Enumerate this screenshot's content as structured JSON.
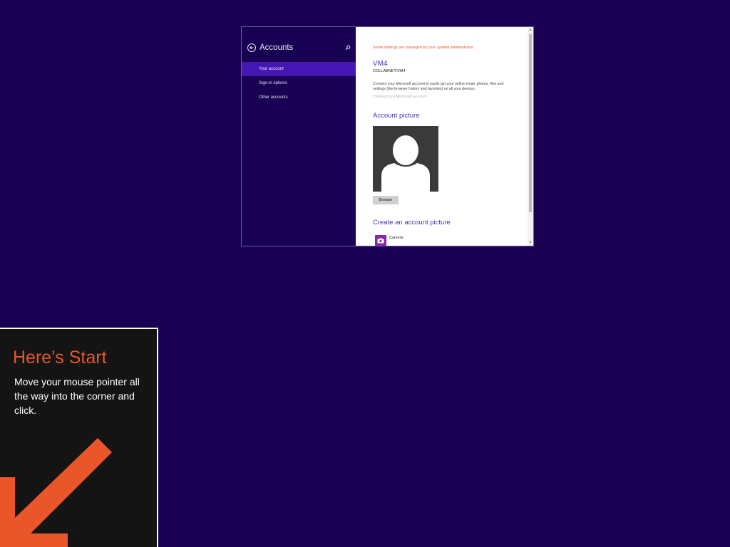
{
  "window": {
    "nav": {
      "title": "Accounts",
      "back_icon": "back-arrow-icon",
      "search_icon": "search-icon",
      "items": [
        {
          "label": "Your account",
          "selected": true
        },
        {
          "label": "Sign-in options",
          "selected": false
        },
        {
          "label": "Other accounts",
          "selected": false
        }
      ]
    },
    "content": {
      "admin_message": "Some settings are managed by your system administrator.",
      "user_name": "VM4",
      "user_domain": "COLLABNET\\VM4",
      "connect_text": "Connect your Microsoft account to easily get your online email, photos, files and settings (like browser history and favorites) on all your devices.",
      "connect_link": "Connect to a Microsoft account",
      "picture_title": "Account picture",
      "browse_label": "Browse",
      "create_title": "Create an account picture",
      "camera_label": "Camera"
    }
  },
  "start_tip": {
    "title": "Here’s Start",
    "body": "Move your mouse pointer all the way into the corner and click."
  },
  "colors": {
    "desktop_bg": "#180053",
    "accent": "#4617b4",
    "tip_accent": "#e8562a"
  }
}
